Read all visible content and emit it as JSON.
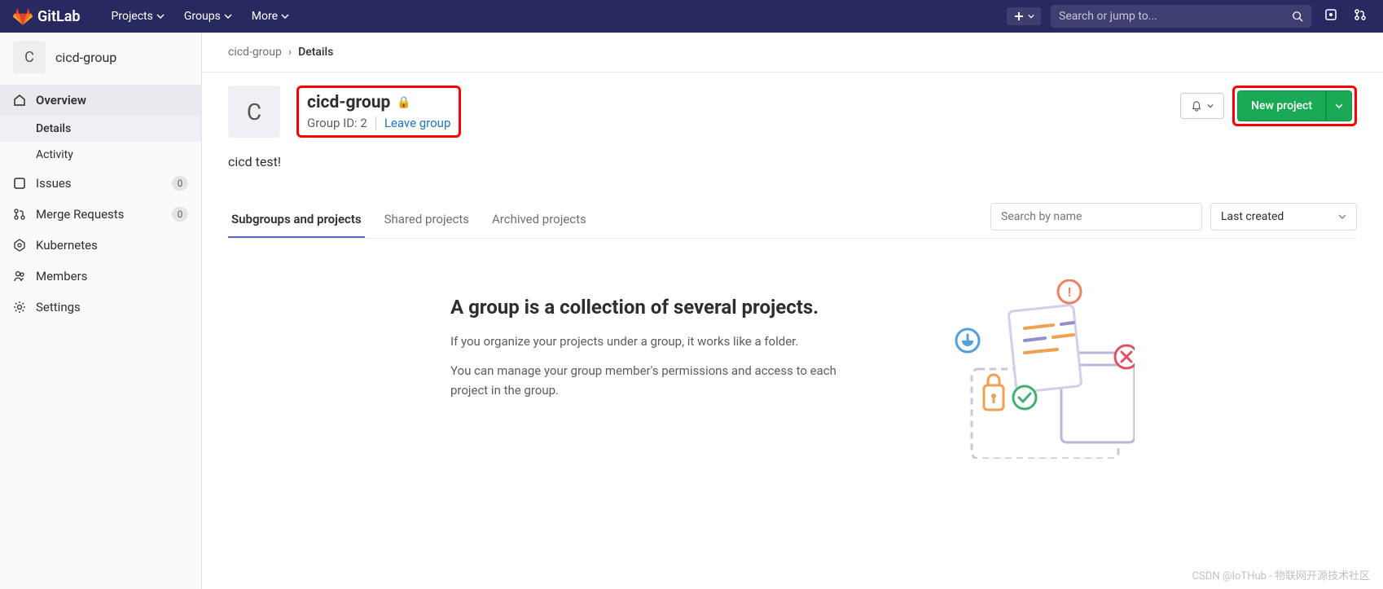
{
  "navbar": {
    "brand": "GitLab",
    "menu": [
      "Projects",
      "Groups",
      "More"
    ],
    "search_placeholder": "Search or jump to..."
  },
  "sidebar": {
    "avatar_letter": "C",
    "title": "cicd-group",
    "items": [
      {
        "label": "Overview",
        "icon": "home",
        "active": true,
        "sub": [
          {
            "label": "Details",
            "active": true
          },
          {
            "label": "Activity",
            "active": false
          }
        ]
      },
      {
        "label": "Issues",
        "icon": "issues",
        "badge": "0"
      },
      {
        "label": "Merge Requests",
        "icon": "merge",
        "badge": "0"
      },
      {
        "label": "Kubernetes",
        "icon": "kube"
      },
      {
        "label": "Members",
        "icon": "members"
      },
      {
        "label": "Settings",
        "icon": "settings"
      }
    ]
  },
  "breadcrumb": {
    "parent": "cicd-group",
    "current": "Details"
  },
  "group": {
    "avatar_letter": "C",
    "name": "cicd-group",
    "id_label": "Group ID: 2",
    "leave_label": "Leave group",
    "description": "cicd test!",
    "new_project_label": "New project"
  },
  "tabs": {
    "items": [
      "Subgroups and projects",
      "Shared projects",
      "Archived projects"
    ],
    "active": 0,
    "search_placeholder": "Search by name",
    "sort_label": "Last created"
  },
  "empty": {
    "heading": "A group is a collection of several projects.",
    "p1": "If you organize your projects under a group, it works like a folder.",
    "p2": "You can manage your group member's permissions and access to each project in the group."
  },
  "watermark": "CSDN @IoTHub - 物联网开源技术社区"
}
